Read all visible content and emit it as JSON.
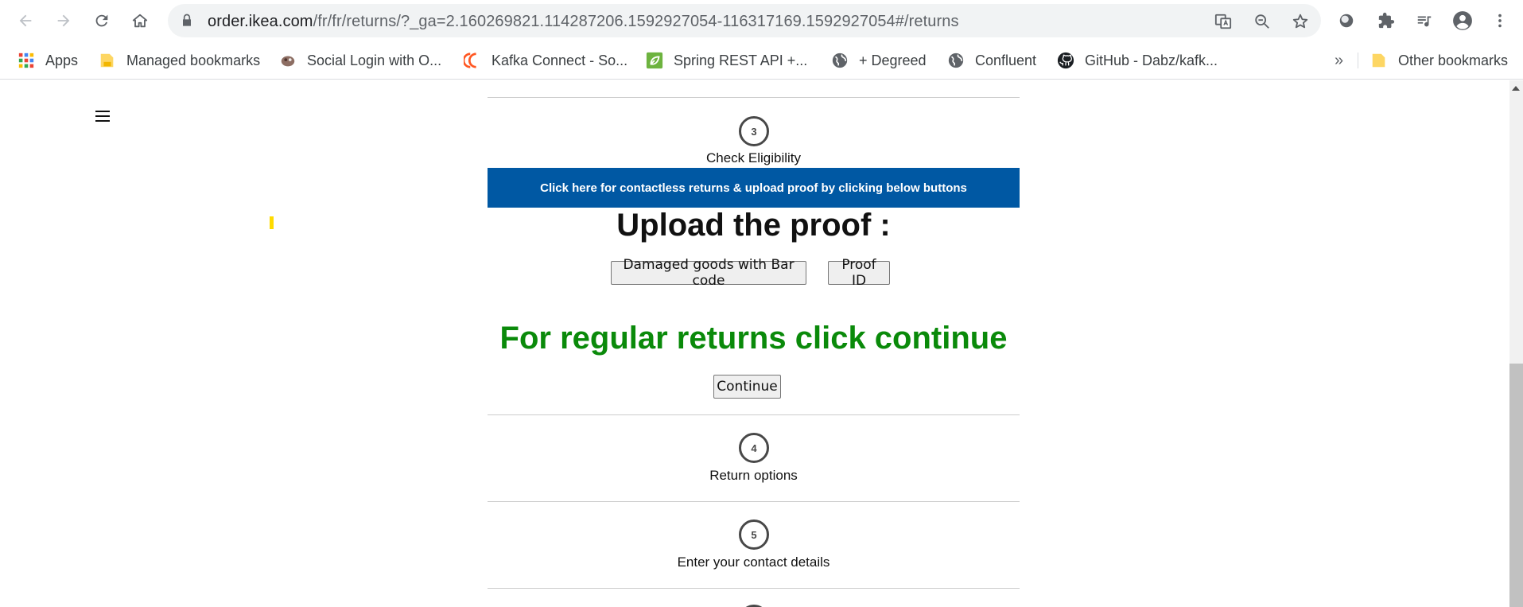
{
  "browser": {
    "url_host": "order.ikea.com",
    "url_path": "/fr/fr/returns/?_ga=2.160269821.114287206.1592927054-116317169.1592927054#/returns"
  },
  "bookmarks": {
    "items": [
      {
        "label": "Apps",
        "icon": "apps-grid-icon"
      },
      {
        "label": "Managed bookmarks",
        "icon": "folder-icon"
      },
      {
        "label": "Social Login with O...",
        "icon": "favicon-icon"
      },
      {
        "label": "Kafka Connect - So...",
        "icon": "confluent-icon"
      },
      {
        "label": "Spring REST API +...",
        "icon": "leaf-icon"
      },
      {
        "label": "+ Degreed",
        "icon": "globe-icon"
      },
      {
        "label": "Confluent",
        "icon": "globe-icon"
      },
      {
        "label": "GitHub - Dabz/kafk...",
        "icon": "github-icon"
      }
    ],
    "overflow_label": "»",
    "other_label": "Other bookmarks"
  },
  "steps": {
    "step3": {
      "number": "3",
      "label": "Check Eligibility"
    },
    "step4": {
      "number": "4",
      "label": "Return options"
    },
    "step5": {
      "number": "5",
      "label": "Enter your contact details"
    }
  },
  "banner": {
    "text": "Click here for contactless returns & upload proof by clicking below buttons"
  },
  "upload": {
    "heading": "Upload the proof :",
    "btn_damaged": "Damaged goods with Bar code",
    "btn_proof": "Proof ID"
  },
  "regular": {
    "heading": "For regular returns click continue",
    "btn_continue": "Continue"
  },
  "colors": {
    "banner": "#0058a3",
    "green_heading": "#0a8a0a",
    "marker": "#ffdb00"
  }
}
